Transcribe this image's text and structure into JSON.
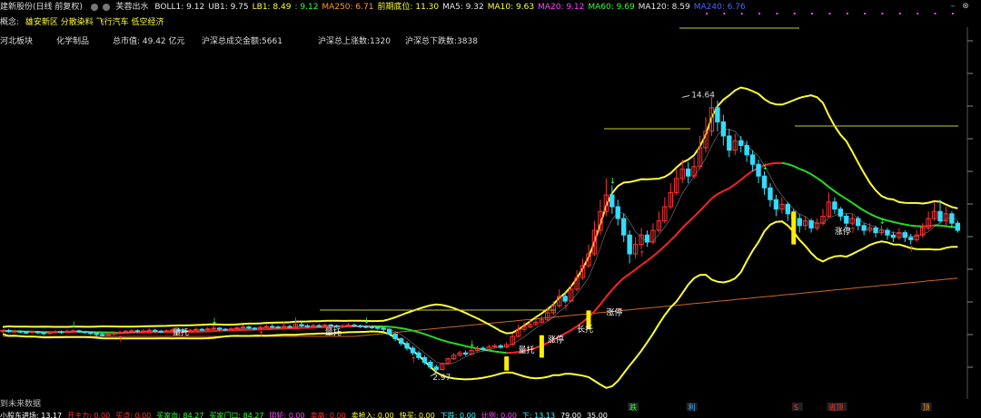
{
  "header": {
    "stock_title": "建新股份(日线 前复权)",
    "indicator_name": "芙蓉出水",
    "items": [
      {
        "label": "BOLL1: 9.12",
        "color": "#e6e6e6"
      },
      {
        "label": "UB1: 9.75",
        "color": "#e6e6e6"
      },
      {
        "label": "LB1: 8.49",
        "color": "#ffff33"
      },
      {
        "label": ": 9.12",
        "color": "#33ff33"
      },
      {
        "label": "MA250: 6.71",
        "color": "#ff9933"
      },
      {
        "label": "前期底位: 11.30",
        "color": "#ffff33"
      },
      {
        "label": "MA5: 9.32",
        "color": "#e6e6e6"
      },
      {
        "label": "MA10: 9.63",
        "color": "#ffff33"
      },
      {
        "label": "MA20: 9.12",
        "color": "#ff44ff"
      },
      {
        "label": "MA60: 9.69",
        "color": "#33ff33"
      },
      {
        "label": "MA120: 8.59",
        "color": "#e6e6e6"
      },
      {
        "label": "MA240: 6.76",
        "color": "#4466ff"
      }
    ]
  },
  "concepts": {
    "prefix": "概念:",
    "text": "雄安新区 分散染料 飞行汽车 低空经济"
  },
  "info_row": {
    "region": "河北板块",
    "industry": "化学制品",
    "market_cap": "总市值: 49.42 亿元",
    "turnover": "沪深总成交金额:5661",
    "up_count": "沪深总上涨数:1320",
    "down_count": "沪深总下跌数:3838"
  },
  "no_future_text": "到未来数据",
  "footer_label": "小股东进场",
  "chart_data": {
    "type": "candlestick",
    "price_axis_range": [
      2.5,
      15.5
    ],
    "high_marker": "14.64",
    "low_marker": "2.97",
    "candles": [
      [
        4.7,
        4.75,
        4.8,
        4.65
      ],
      [
        4.75,
        4.7,
        4.82,
        4.66
      ],
      [
        4.7,
        4.72,
        4.78,
        4.64
      ],
      [
        4.72,
        4.68,
        4.76,
        4.62
      ],
      [
        4.68,
        4.66,
        4.72,
        4.6
      ],
      [
        4.66,
        4.7,
        4.75,
        4.62
      ],
      [
        4.7,
        4.65,
        4.74,
        4.6
      ],
      [
        4.65,
        4.62,
        4.7,
        4.56
      ],
      [
        4.62,
        4.66,
        4.72,
        4.58
      ],
      [
        4.66,
        4.7,
        4.76,
        4.62
      ],
      [
        4.7,
        4.68,
        4.76,
        4.62
      ],
      [
        4.68,
        4.72,
        4.8,
        4.64
      ],
      [
        4.72,
        4.74,
        4.8,
        4.66
      ],
      [
        4.74,
        4.7,
        4.78,
        4.64
      ],
      [
        4.7,
        4.66,
        4.74,
        4.6
      ],
      [
        4.66,
        4.62,
        4.7,
        4.56
      ],
      [
        4.62,
        4.58,
        4.66,
        4.5
      ],
      [
        4.58,
        4.55,
        4.64,
        4.48
      ],
      [
        4.55,
        4.6,
        4.66,
        4.5
      ],
      [
        4.6,
        4.64,
        4.7,
        4.54
      ],
      [
        4.64,
        4.68,
        4.74,
        4.58
      ],
      [
        4.68,
        4.72,
        4.78,
        4.64
      ],
      [
        4.72,
        4.74,
        4.8,
        4.66
      ],
      [
        4.74,
        4.7,
        4.8,
        4.64
      ],
      [
        4.7,
        4.73,
        4.8,
        4.66
      ],
      [
        4.73,
        4.76,
        4.84,
        4.68
      ],
      [
        4.76,
        4.72,
        4.82,
        4.66
      ],
      [
        4.72,
        4.7,
        4.78,
        4.64
      ],
      [
        4.7,
        4.74,
        4.8,
        4.66
      ],
      [
        4.74,
        4.78,
        4.86,
        4.7
      ],
      [
        4.78,
        4.75,
        4.84,
        4.7
      ],
      [
        4.75,
        4.72,
        4.8,
        4.66
      ],
      [
        4.72,
        4.76,
        4.82,
        4.68
      ],
      [
        4.76,
        4.8,
        4.88,
        4.72
      ],
      [
        4.8,
        4.78,
        4.86,
        4.72
      ],
      [
        4.78,
        4.82,
        4.9,
        4.74
      ],
      [
        4.82,
        4.85,
        4.96,
        4.76
      ],
      [
        4.85,
        4.8,
        4.9,
        4.74
      ],
      [
        4.8,
        4.78,
        4.86,
        4.72
      ],
      [
        4.78,
        4.82,
        4.88,
        4.74
      ],
      [
        4.82,
        4.86,
        4.94,
        4.78
      ],
      [
        4.86,
        4.9,
        4.98,
        4.82
      ],
      [
        4.9,
        4.85,
        4.96,
        4.8
      ],
      [
        4.85,
        4.82,
        4.9,
        4.76
      ],
      [
        4.82,
        4.88,
        4.96,
        4.78
      ],
      [
        4.88,
        4.92,
        5.0,
        4.84
      ],
      [
        4.92,
        4.9,
        5.02,
        4.84
      ],
      [
        4.9,
        4.88,
        4.96,
        4.82
      ],
      [
        4.88,
        4.92,
        5.1,
        4.84
      ],
      [
        4.92,
        4.9,
        5.0,
        4.84
      ],
      [
        4.9,
        5.0,
        5.3,
        4.86
      ],
      [
        5.0,
        4.95,
        5.1,
        4.88
      ],
      [
        4.95,
        4.92,
        5.02,
        4.86
      ],
      [
        4.92,
        4.96,
        5.04,
        4.88
      ],
      [
        4.96,
        4.94,
        5.02,
        4.88
      ],
      [
        4.94,
        4.98,
        5.06,
        4.9
      ],
      [
        4.98,
        4.95,
        5.04,
        4.9
      ],
      [
        4.95,
        4.92,
        5.0,
        4.86
      ],
      [
        4.92,
        4.95,
        5.02,
        4.86
      ],
      [
        4.95,
        4.98,
        5.06,
        4.9
      ],
      [
        4.98,
        4.95,
        5.04,
        4.9
      ],
      [
        4.95,
        4.92,
        5.0,
        4.86
      ],
      [
        4.92,
        4.9,
        4.98,
        4.84
      ],
      [
        4.9,
        4.88,
        4.96,
        4.82
      ],
      [
        4.88,
        4.85,
        4.92,
        4.78
      ],
      [
        4.85,
        4.8,
        4.9,
        4.72
      ],
      [
        4.8,
        4.6,
        4.84,
        4.55
      ],
      [
        4.6,
        4.4,
        4.64,
        4.3
      ],
      [
        4.4,
        4.2,
        4.45,
        4.1
      ],
      [
        4.2,
        4.0,
        4.3,
        3.9
      ],
      [
        4.0,
        3.8,
        4.1,
        3.7
      ],
      [
        3.8,
        3.6,
        3.9,
        3.5
      ],
      [
        3.6,
        3.4,
        3.7,
        3.3
      ],
      [
        3.4,
        3.2,
        3.5,
        3.1
      ],
      [
        3.2,
        3.1,
        3.3,
        2.97
      ],
      [
        3.1,
        3.35,
        3.4,
        3.05
      ],
      [
        3.35,
        3.55,
        3.6,
        3.3
      ],
      [
        3.55,
        3.7,
        3.8,
        3.5
      ],
      [
        3.7,
        3.8,
        3.9,
        3.65
      ],
      [
        3.8,
        3.75,
        3.9,
        3.68
      ],
      [
        3.75,
        3.9,
        4.0,
        3.7
      ],
      [
        3.9,
        4.0,
        4.1,
        3.85
      ],
      [
        4.0,
        3.95,
        4.08,
        3.88
      ],
      [
        3.95,
        4.05,
        4.15,
        3.9
      ],
      [
        4.05,
        4.1,
        4.2,
        4.0
      ],
      [
        4.1,
        4.05,
        4.18,
        3.98
      ],
      [
        4.05,
        4.15,
        4.25,
        4.0
      ],
      [
        4.15,
        4.5,
        4.6,
        4.1
      ],
      [
        4.5,
        4.8,
        5.0,
        4.45
      ],
      [
        4.8,
        4.9,
        5.1,
        4.7
      ],
      [
        4.9,
        5.0,
        5.2,
        4.85
      ],
      [
        5.0,
        5.1,
        5.3,
        4.95
      ],
      [
        5.1,
        5.2,
        5.35,
        5.05
      ],
      [
        5.2,
        5.5,
        5.7,
        5.15
      ],
      [
        5.5,
        5.8,
        6.0,
        5.4
      ],
      [
        5.8,
        6.2,
        6.5,
        5.7
      ],
      [
        6.2,
        6.0,
        6.4,
        5.9
      ],
      [
        6.0,
        6.5,
        6.7,
        5.95
      ],
      [
        6.5,
        7.0,
        7.3,
        6.4
      ],
      [
        7.0,
        7.5,
        7.8,
        6.9
      ],
      [
        7.5,
        8.0,
        8.4,
        7.4
      ],
      [
        8.0,
        9.0,
        9.4,
        7.9
      ],
      [
        9.0,
        9.8,
        10.3,
        8.8
      ],
      [
        9.8,
        10.5,
        11.2,
        9.6
      ],
      [
        10.5,
        10.0,
        10.9,
        9.7
      ],
      [
        10.0,
        9.5,
        10.3,
        9.2
      ],
      [
        9.5,
        8.8,
        9.7,
        8.5
      ],
      [
        8.8,
        8.0,
        9.0,
        7.6
      ],
      [
        8.0,
        8.4,
        8.7,
        7.8
      ],
      [
        8.4,
        8.8,
        9.1,
        8.2
      ],
      [
        8.8,
        8.5,
        9.0,
        8.3
      ],
      [
        8.5,
        9.0,
        9.3,
        8.4
      ],
      [
        9.0,
        9.4,
        9.8,
        8.9
      ],
      [
        9.4,
        10.0,
        10.4,
        9.3
      ],
      [
        10.0,
        10.6,
        11.0,
        9.9
      ],
      [
        10.6,
        11.2,
        11.6,
        10.5
      ],
      [
        11.2,
        11.6,
        12.0,
        11.0
      ],
      [
        11.6,
        11.3,
        11.9,
        11.0
      ],
      [
        11.3,
        11.7,
        12.1,
        11.2
      ],
      [
        11.7,
        12.5,
        13.0,
        11.6
      ],
      [
        12.5,
        13.2,
        13.8,
        12.3
      ],
      [
        13.2,
        14.2,
        14.64,
        13.0
      ],
      [
        14.2,
        13.6,
        14.5,
        13.2
      ],
      [
        13.6,
        13.0,
        13.9,
        12.6
      ],
      [
        13.0,
        12.4,
        13.3,
        12.1
      ],
      [
        12.4,
        12.8,
        13.1,
        12.2
      ],
      [
        12.8,
        12.6,
        13.0,
        12.3
      ],
      [
        12.6,
        12.2,
        12.8,
        11.9
      ],
      [
        12.2,
        11.8,
        12.4,
        11.5
      ],
      [
        11.8,
        11.3,
        12.0,
        11.0
      ],
      [
        11.3,
        10.8,
        11.5,
        10.5
      ],
      [
        10.8,
        10.3,
        11.0,
        10.0
      ],
      [
        10.3,
        9.9,
        10.5,
        9.6
      ],
      [
        9.9,
        10.1,
        10.4,
        9.7
      ],
      [
        10.1,
        9.7,
        10.2,
        9.4
      ],
      [
        9.7,
        9.5,
        9.9,
        9.2
      ],
      [
        9.5,
        9.2,
        9.7,
        8.9
      ],
      [
        9.2,
        9.4,
        9.6,
        9.0
      ],
      [
        9.4,
        9.1,
        9.5,
        8.9
      ],
      [
        9.1,
        9.3,
        9.5,
        9.0
      ],
      [
        9.3,
        9.6,
        9.9,
        9.2
      ],
      [
        9.6,
        10.2,
        10.6,
        9.5
      ],
      [
        10.2,
        9.9,
        10.4,
        9.7
      ],
      [
        9.9,
        9.6,
        10.0,
        9.4
      ],
      [
        9.6,
        9.3,
        9.7,
        9.1
      ],
      [
        9.3,
        9.5,
        9.7,
        9.2
      ],
      [
        9.5,
        9.2,
        9.6,
        9.0
      ],
      [
        9.2,
        9.0,
        9.3,
        8.8
      ],
      [
        9.0,
        9.1,
        9.3,
        8.9
      ],
      [
        9.1,
        8.9,
        9.2,
        8.7
      ],
      [
        8.9,
        9.0,
        9.2,
        8.8
      ],
      [
        9.0,
        8.8,
        9.1,
        8.6
      ],
      [
        8.8,
        8.7,
        8.95,
        8.5
      ],
      [
        8.7,
        8.9,
        9.1,
        8.6
      ],
      [
        8.9,
        8.7,
        9.0,
        8.5
      ],
      [
        8.7,
        8.6,
        8.85,
        8.4
      ],
      [
        8.6,
        8.8,
        9.0,
        8.5
      ],
      [
        8.8,
        9.1,
        9.3,
        8.7
      ],
      [
        9.1,
        9.5,
        9.8,
        9.0
      ],
      [
        9.5,
        9.8,
        10.2,
        9.4
      ],
      [
        9.8,
        9.4,
        10.3,
        9.3
      ],
      [
        9.4,
        9.7,
        10.0,
        9.2
      ],
      [
        9.7,
        9.3,
        9.8,
        9.1
      ],
      [
        9.3,
        9.0,
        9.4,
        8.9
      ]
    ]
  },
  "signals": [
    {
      "text": "量托",
      "color": "#ffffff",
      "idx": 29,
      "price": 4.55
    },
    {
      "text": "量托",
      "color": "#ffffff",
      "idx": 55,
      "price": 4.55
    },
    {
      "text": "量托",
      "color": "#ffffff",
      "idx": 88,
      "price": 3.8
    },
    {
      "text": "涨停",
      "color": "#ffffff",
      "idx": 93,
      "price": 4.25
    },
    {
      "text": "长托",
      "color": "#ffffff",
      "idx": 98,
      "price": 4.7
    },
    {
      "text": "涨停",
      "color": "#ffffff",
      "idx": 103,
      "price": 5.4
    },
    {
      "text": "涨停",
      "color": "#ffffff",
      "idx": 142,
      "price": 8.85
    }
  ],
  "bottom_tags": [
    {
      "text": "跌",
      "color": "#33ff33",
      "idx": 107
    },
    {
      "text": "利",
      "color": "#33aaff",
      "idx": 117
    },
    {
      "text": "S",
      "color": "#ff3333",
      "idx": 135
    },
    {
      "text": "逃顶",
      "color": "#ff3333",
      "idx": 141
    },
    {
      "text": "顶",
      "color": "#ff9933",
      "idx": 157
    }
  ],
  "footer_items": [
    {
      "text": "小股东进场: 13.17",
      "color": "#ffffff"
    },
    {
      "text": "开主力: 0.00",
      "color": "#ff3333"
    },
    {
      "text": "买点: 0.00",
      "color": "#ff3333"
    },
    {
      "text": "买家血: 84.27",
      "color": "#33ff33"
    },
    {
      "text": "买家门口: 84.27",
      "color": "#33ff33"
    },
    {
      "text": "阻轮: 0.00",
      "color": "#ff44ff"
    },
    {
      "text": "卖高: 0.00",
      "color": "#ff3333"
    },
    {
      "text": "卖抢入: 0.00",
      "color": "#ffff33"
    },
    {
      "text": "快买: 0.00",
      "color": "#ffff33"
    },
    {
      "text": "下跌: 0.00",
      "color": "#33ffff"
    },
    {
      "text": "比例: 0.00",
      "color": "#ff44ff"
    },
    {
      "text": "下: 13.13",
      "color": "#33ffff"
    },
    {
      "text": "79.00",
      "color": "#ffffff"
    },
    {
      "text": "35.00",
      "color": "#ffffff"
    }
  ]
}
